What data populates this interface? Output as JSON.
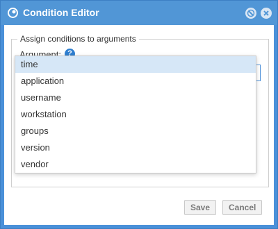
{
  "window": {
    "title": "Condition Editor",
    "icons": [
      "app-logo-icon",
      "minimize-icon",
      "close-icon"
    ]
  },
  "fieldset": {
    "legend": "Assign conditions to arguments",
    "argument_label": "Argument:",
    "help_glyph": "?"
  },
  "combo": {
    "value": ""
  },
  "dropdown": {
    "selected": "time",
    "options": [
      "time",
      "application",
      "username",
      "workstation",
      "groups",
      "version",
      "vendor"
    ]
  },
  "buttons": {
    "save": "Save",
    "cancel": "Cancel"
  },
  "colors": {
    "titlebar": "#5196d6",
    "selection": "#d6e7f7",
    "accent": "#4a90d9"
  }
}
